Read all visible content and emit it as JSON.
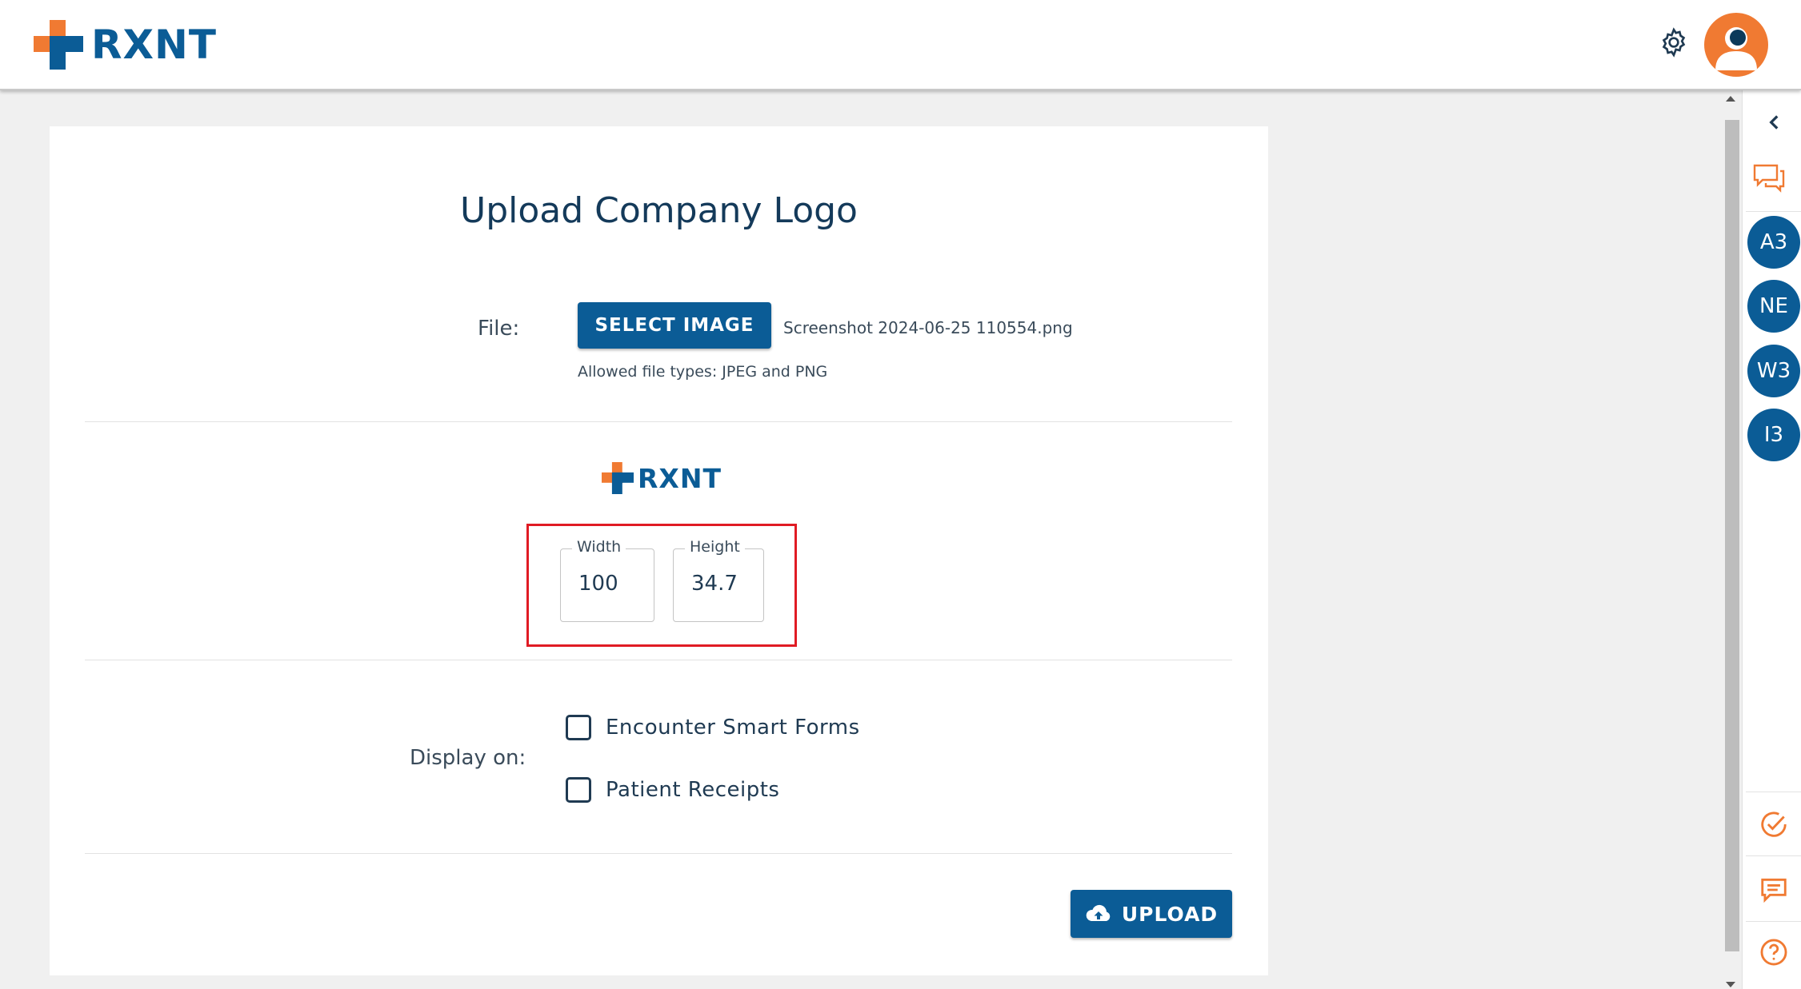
{
  "header": {
    "brand": "RXNT",
    "settings_icon": "gear-icon",
    "profile_icon": "user-avatar-icon"
  },
  "main": {
    "title": "Upload Company Logo",
    "file_label": "File:",
    "select_button": "SELECT IMAGE",
    "file_name": "Screenshot 2024-06-25 110554.png",
    "allowed_types": "Allowed file types: JPEG and PNG",
    "preview_brand": "RXNT",
    "width_label": "Width",
    "width_value": "100",
    "height_label": "Height",
    "height_value": "34.7",
    "display_label": "Display on:",
    "options": [
      {
        "label": "Encounter Smart Forms",
        "checked": false
      },
      {
        "label": "Patient Receipts",
        "checked": false
      }
    ],
    "upload_button": "UPLOAD"
  },
  "rail": {
    "bubbles": [
      "A3",
      "NE",
      "W3",
      "I3"
    ],
    "icons": [
      "chevron-left-icon",
      "chat-icon",
      "check-circle-icon",
      "message-icon",
      "help-icon"
    ]
  },
  "colors": {
    "brand_blue": "#0b5c96",
    "brand_orange": "#f07a32",
    "highlight_red": "#e01b24"
  }
}
